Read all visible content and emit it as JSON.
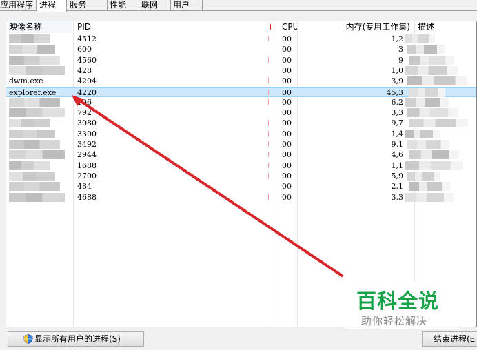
{
  "tabs": [
    "应用程序",
    "进程",
    "服务",
    "性能",
    "联网",
    "用户"
  ],
  "columns": {
    "name": "映像名称",
    "pid": "PID",
    "user": "",
    "cpu": "CPU",
    "memory": "内存(专用工作集)",
    "description": "描述"
  },
  "rows": [
    {
      "name": "",
      "pid": "4512",
      "cpu": "00",
      "memory": "1,2"
    },
    {
      "name": "",
      "pid": "600",
      "cpu": "00",
      "memory": "3"
    },
    {
      "name": "",
      "pid": "4560",
      "cpu": "00",
      "memory": "9"
    },
    {
      "name": "",
      "pid": "428",
      "cpu": "00",
      "memory": "1,0"
    },
    {
      "name": "dwm.exe",
      "pid": "4204",
      "cpu": "00",
      "memory": "3,9"
    },
    {
      "name": "explorer.exe",
      "pid": "4220",
      "cpu": "00",
      "memory": "45,3"
    },
    {
      "name": "",
      "pid": "196",
      "cpu": "00",
      "memory": "6,2"
    },
    {
      "name": "",
      "pid": "792",
      "cpu": "00",
      "memory": "3,3"
    },
    {
      "name": "",
      "pid": "3080",
      "cpu": "00",
      "memory": "9,7"
    },
    {
      "name": "",
      "pid": "3300",
      "cpu": "00",
      "memory": "1,4"
    },
    {
      "name": "",
      "pid": "3492",
      "cpu": "00",
      "memory": "9,1"
    },
    {
      "name": "",
      "pid": "2944",
      "cpu": "00",
      "memory": "4,6"
    },
    {
      "name": "",
      "pid": "1688",
      "cpu": "00",
      "memory": "1,1"
    },
    {
      "name": "",
      "pid": "2700",
      "cpu": "00",
      "memory": "5,9"
    },
    {
      "name": "",
      "pid": "484",
      "cpu": "00",
      "memory": "2,1"
    },
    {
      "name": "",
      "pid": "4688",
      "cpu": "00",
      "memory": "3,3"
    }
  ],
  "selected_row": "explorer.exe",
  "buttons": {
    "show_all": "显示所有用户的进程(S)",
    "end_process": "结束进程(E"
  },
  "watermark": {
    "title": "百科全说",
    "subtitle": "助你轻松解决"
  },
  "colors": {
    "selection": "#cce8ff",
    "arrow": "#d9262b",
    "watermark": "#17a34a"
  },
  "icons": [
    "uac-shield-icon"
  ]
}
